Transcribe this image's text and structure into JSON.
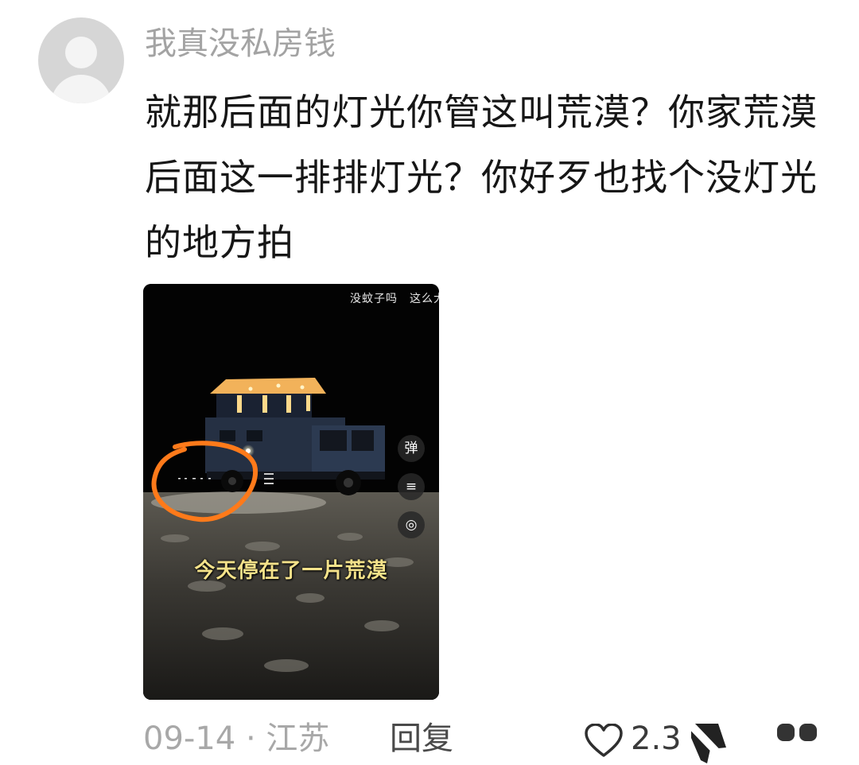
{
  "comment": {
    "username": "我真没私房钱",
    "text": "就那后面的灯光你管这叫荒漠？你家荒漠后面这一排排灯光？你好歹也找个没灯光的地方拍",
    "media": {
      "overlay_top_text": "没蚊子吗　这么大",
      "subtitle": "今天停在了一片荒漠",
      "side_buttons": [
        "弹",
        "≡",
        "◎"
      ]
    },
    "footer": {
      "date_location": "09-14 · 江苏",
      "reply_label": "回复",
      "like_count": "2.3"
    }
  },
  "colors": {
    "username": "#a3a3a3",
    "text": "#161616",
    "annotation_circle": "#ff7a1a",
    "subtitle": "#f4e28a"
  },
  "icons": {
    "avatar": "default-avatar-icon",
    "like": "heart-outline-icon",
    "dislike": "thumbs-down-icon",
    "more": "more-icon"
  }
}
